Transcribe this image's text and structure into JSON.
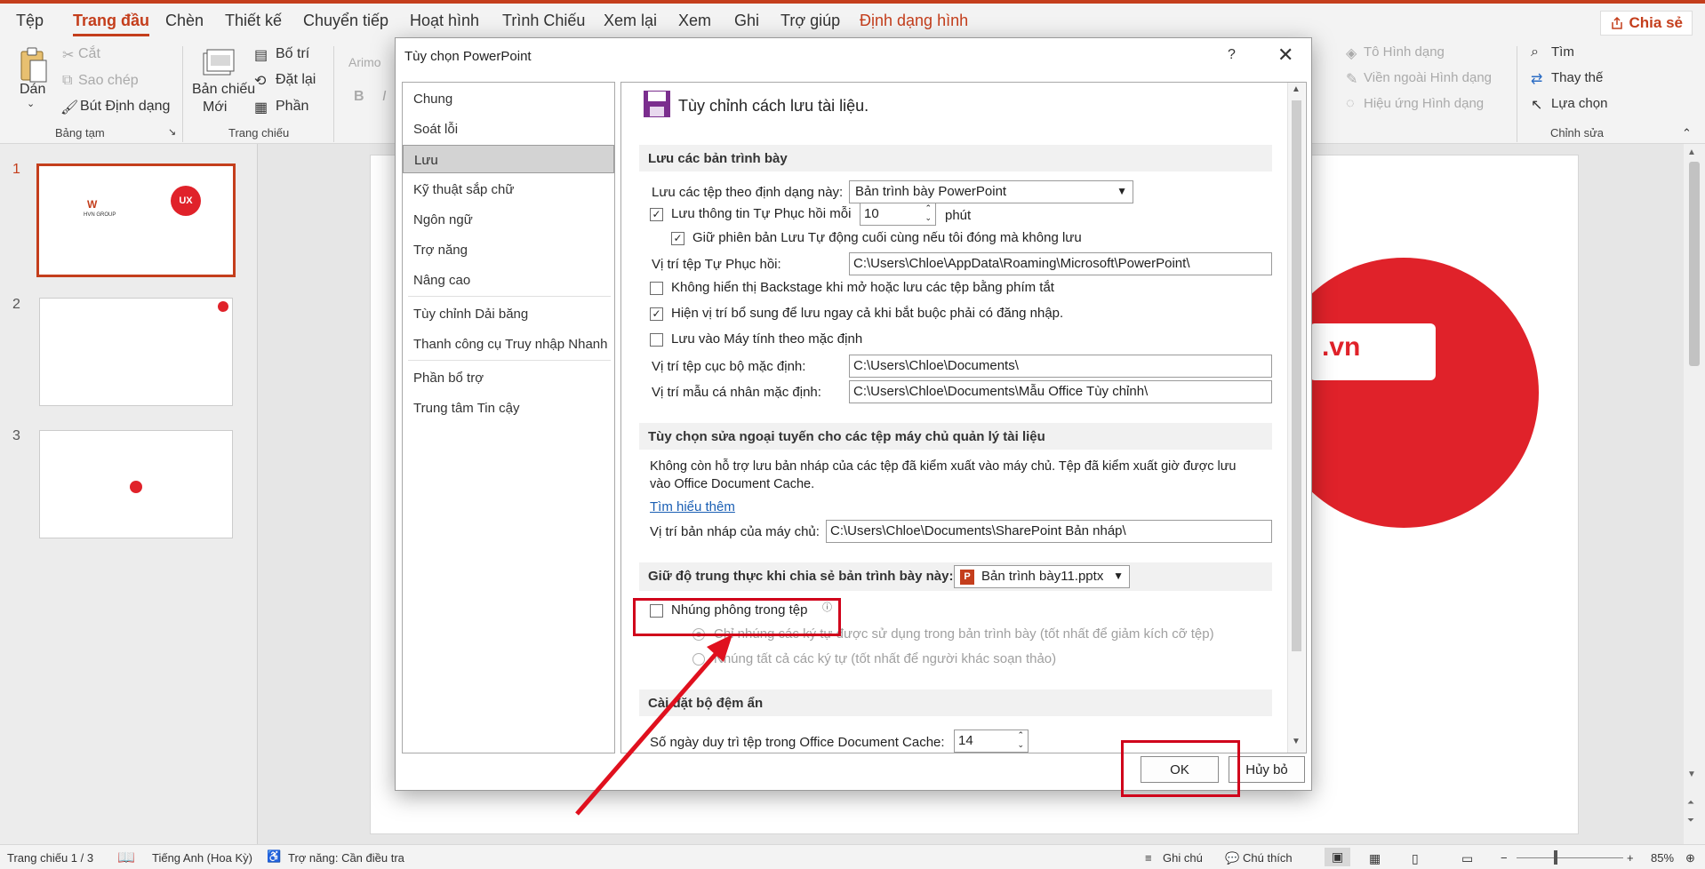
{
  "ribbon_tabs": [
    "Tệp",
    "Trang đầu",
    "Chèn",
    "Thiết kế",
    "Chuyển tiếp",
    "Hoạt hình",
    "Trình Chiếu",
    "Xem lại",
    "Xem",
    "Ghi",
    "Trợ giúp",
    "Định dạng hình"
  ],
  "share_label": "Chia sẻ",
  "ribbon": {
    "paste": "Dán",
    "cut": "Cắt",
    "copy": "Sao chép",
    "format_painter": "Bút Định dạng",
    "clipboard_group": "Bảng tạm",
    "new_slide_line1": "Bản chiếu",
    "new_slide_line2": "Mới",
    "layout": "Bố trí",
    "reset": "Đặt lại",
    "section": "Phần",
    "slides_group": "Trang chiếu",
    "font_name": "Arimo",
    "bold": "B",
    "italic": "I",
    "shape_fill": "Tô Hình dạng",
    "shape_outline": "Viền ngoài Hình dạng",
    "shape_effects": "Hiệu ứng Hình dạng",
    "find": "Tìm",
    "replace": "Thay thế",
    "select": "Lựa chọn",
    "editing_group": "Chỉnh sửa"
  },
  "thumbnails": [
    "1",
    "2",
    "3"
  ],
  "slide_brand_text": ".vn",
  "thumb1_brand": "HVN GROUP",
  "thumb1_logo": "UX",
  "dialog": {
    "title": "Tùy chọn PowerPoint",
    "help": "?",
    "close": "✕",
    "nav": [
      "Chung",
      "Soát lỗi",
      "Lưu",
      "Kỹ thuật sắp chữ",
      "Ngôn ngữ",
      "Trợ năng",
      "Nâng cao",
      "Tùy chỉnh Dải băng",
      "Thanh công cụ Truy nhập Nhanh",
      "Phần bổ trợ",
      "Trung tâm Tin cậy"
    ],
    "header": "Tùy chỉnh cách lưu tài liệu.",
    "save_presentations": {
      "heading": "Lưu các bản trình bày",
      "format_label": "Lưu các tệp theo định dạng này:",
      "format_value": "Bản trình bày PowerPoint",
      "autorecover_label": "Lưu thông tin Tự Phục hồi mỗi",
      "autorecover_minutes": "10",
      "minutes_unit": "phút",
      "keep_last_label": "Giữ phiên bản Lưu Tự động cuối cùng nếu tôi đóng mà không lưu",
      "autorecover_location_label": "Vị trí tệp Tự Phục hồi:",
      "autorecover_location_value": "C:\\Users\\Chloe\\AppData\\Roaming\\Microsoft\\PowerPoint\\",
      "no_backstage_label": "Không hiển thị Backstage khi mở hoặc lưu các tệp bằng phím tắt",
      "show_additional_label": "Hiện vị trí bổ sung để lưu ngay cả khi bắt buộc phải có đăng nhập.",
      "save_to_computer_label": "Lưu vào Máy tính theo mặc định",
      "default_local_label": "Vị trí tệp cục bộ mặc định:",
      "default_local_value": "C:\\Users\\Chloe\\Documents\\",
      "personal_templates_label": "Vị trí mẫu cá nhân mặc định:",
      "personal_templates_value": "C:\\Users\\Chloe\\Documents\\Mẫu Office Tùy chỉnh\\"
    },
    "offline": {
      "heading": "Tùy chọn sửa ngoại tuyến cho các tệp máy chủ quản lý tài liệu",
      "desc_line1": "Không còn hỗ trợ lưu bản nháp của các tệp đã kiểm xuất vào máy chủ. Tệp đã kiểm xuất giờ được lưu",
      "desc_line2": "vào Office Document Cache.",
      "learn_more": "Tìm hiểu thêm",
      "drafts_label": "Vị trí bản nháp của máy chủ:",
      "drafts_value": "C:\\Users\\Chloe\\Documents\\SharePoint Bản nháp\\"
    },
    "fidelity": {
      "heading": "Giữ độ trung thực khi chia sẻ bản trình bày này:",
      "file_value": "Bản trình bày11.pptx",
      "embed_fonts_label": "Nhúng phông trong tệp",
      "embed_used_label": "Chỉ nhúng các ký tự được sử dụng trong bản trình bày (tốt nhất để giảm kích cỡ tệp)",
      "embed_all_label": "Nhúng tất cả các ký tự (tốt nhất để người khác soạn thảo)"
    },
    "cache": {
      "heading": "Cài đặt bộ đệm ẩn",
      "days_label": "Số ngày duy trì tệp trong Office Document Cache:",
      "days_value": "14"
    },
    "ok": "OK",
    "cancel": "Hủy bỏ"
  },
  "status": {
    "slide_counter": "Trang chiếu 1 / 3",
    "language": "Tiếng Anh (Hoa Kỳ)",
    "accessibility": "Trợ năng: Cần điều tra",
    "notes": "Ghi chú",
    "comments": "Chú thích",
    "zoom": "85%"
  },
  "colors": {
    "accent": "#c43e1c",
    "highlight": "#d0021b",
    "save_icon": "#7b2e8e"
  }
}
